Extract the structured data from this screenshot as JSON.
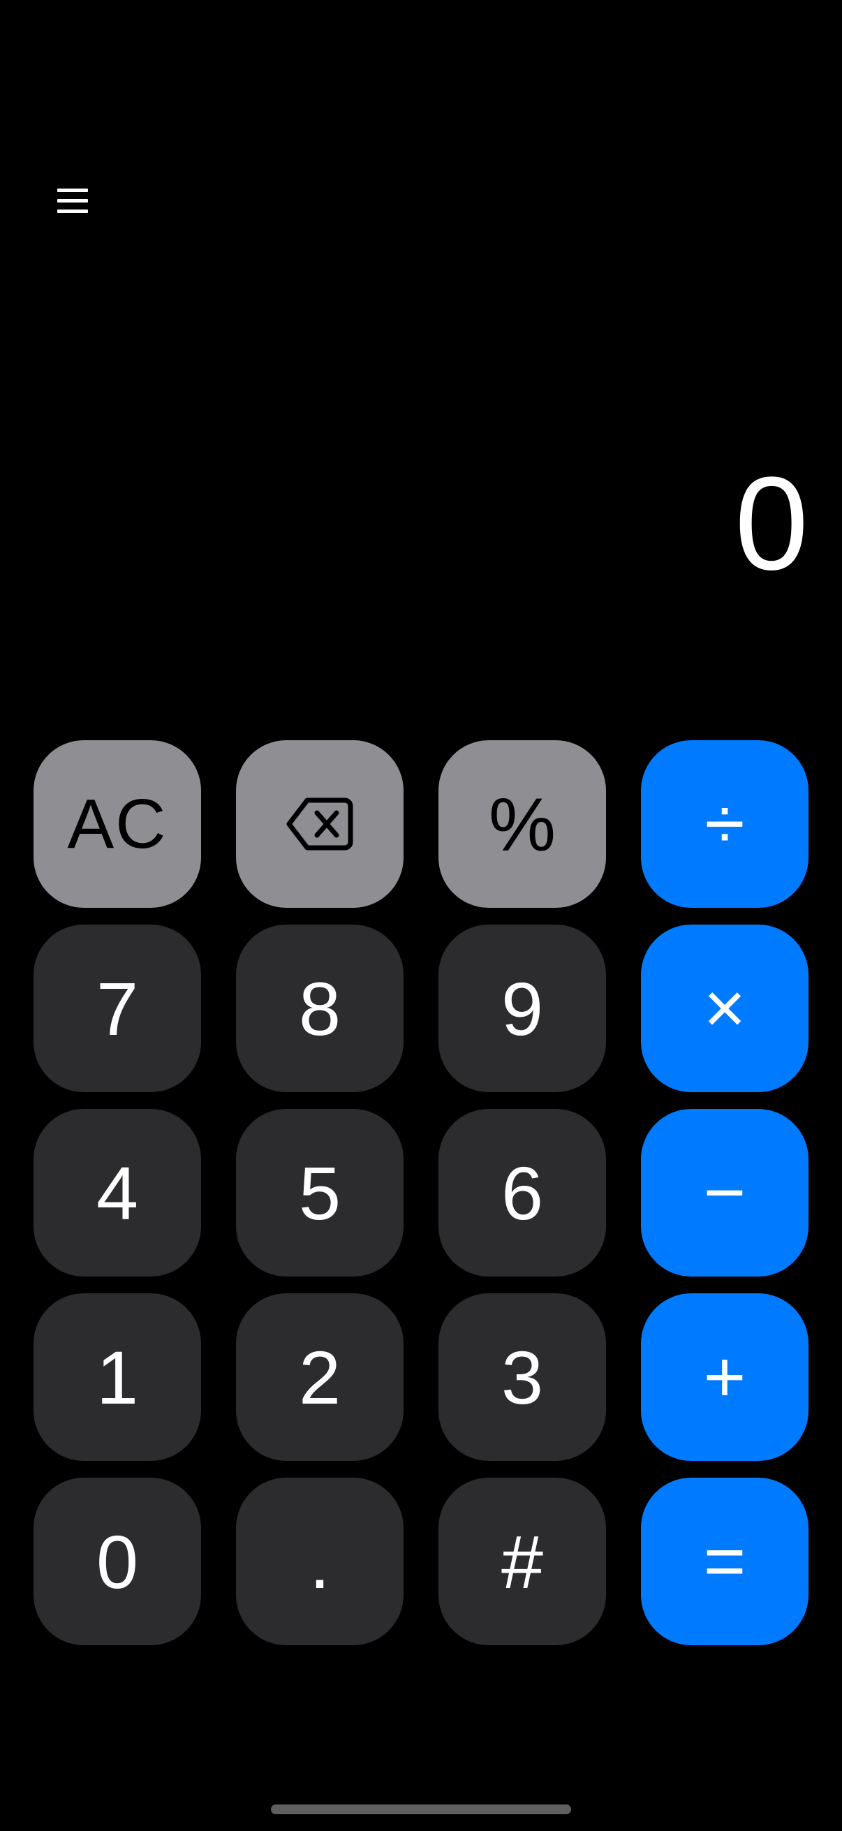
{
  "theme": {
    "background": "#000000",
    "number_key_color": "#2c2c2e",
    "function_key_color": "#8e8e93",
    "operator_key_color": "#007aff",
    "text_color": "#ffffff"
  },
  "header": {
    "menu_icon": "hamburger-menu-icon"
  },
  "display": {
    "value": "0"
  },
  "keypad": {
    "row1": {
      "clear": "AC",
      "backspace_icon": "backspace-icon",
      "percent": "%",
      "divide": "÷"
    },
    "row2": {
      "seven": "7",
      "eight": "8",
      "nine": "9",
      "multiply": "×"
    },
    "row3": {
      "four": "4",
      "five": "5",
      "six": "6",
      "subtract": "−"
    },
    "row4": {
      "one": "1",
      "two": "2",
      "three": "3",
      "add": "+"
    },
    "row5": {
      "zero": "0",
      "decimal": ".",
      "hash": "#",
      "equals": "="
    }
  }
}
